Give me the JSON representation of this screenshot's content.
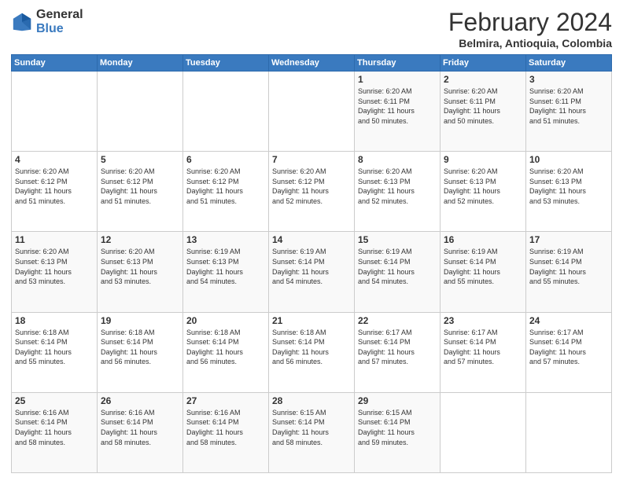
{
  "logo": {
    "general": "General",
    "blue": "Blue"
  },
  "header": {
    "month": "February 2024",
    "location": "Belmira, Antioquia, Colombia"
  },
  "weekdays": [
    "Sunday",
    "Monday",
    "Tuesday",
    "Wednesday",
    "Thursday",
    "Friday",
    "Saturday"
  ],
  "weeks": [
    [
      {
        "day": "",
        "info": ""
      },
      {
        "day": "",
        "info": ""
      },
      {
        "day": "",
        "info": ""
      },
      {
        "day": "",
        "info": ""
      },
      {
        "day": "1",
        "info": "Sunrise: 6:20 AM\nSunset: 6:11 PM\nDaylight: 11 hours\nand 50 minutes."
      },
      {
        "day": "2",
        "info": "Sunrise: 6:20 AM\nSunset: 6:11 PM\nDaylight: 11 hours\nand 50 minutes."
      },
      {
        "day": "3",
        "info": "Sunrise: 6:20 AM\nSunset: 6:11 PM\nDaylight: 11 hours\nand 51 minutes."
      }
    ],
    [
      {
        "day": "4",
        "info": "Sunrise: 6:20 AM\nSunset: 6:12 PM\nDaylight: 11 hours\nand 51 minutes."
      },
      {
        "day": "5",
        "info": "Sunrise: 6:20 AM\nSunset: 6:12 PM\nDaylight: 11 hours\nand 51 minutes."
      },
      {
        "day": "6",
        "info": "Sunrise: 6:20 AM\nSunset: 6:12 PM\nDaylight: 11 hours\nand 51 minutes."
      },
      {
        "day": "7",
        "info": "Sunrise: 6:20 AM\nSunset: 6:12 PM\nDaylight: 11 hours\nand 52 minutes."
      },
      {
        "day": "8",
        "info": "Sunrise: 6:20 AM\nSunset: 6:13 PM\nDaylight: 11 hours\nand 52 minutes."
      },
      {
        "day": "9",
        "info": "Sunrise: 6:20 AM\nSunset: 6:13 PM\nDaylight: 11 hours\nand 52 minutes."
      },
      {
        "day": "10",
        "info": "Sunrise: 6:20 AM\nSunset: 6:13 PM\nDaylight: 11 hours\nand 53 minutes."
      }
    ],
    [
      {
        "day": "11",
        "info": "Sunrise: 6:20 AM\nSunset: 6:13 PM\nDaylight: 11 hours\nand 53 minutes."
      },
      {
        "day": "12",
        "info": "Sunrise: 6:20 AM\nSunset: 6:13 PM\nDaylight: 11 hours\nand 53 minutes."
      },
      {
        "day": "13",
        "info": "Sunrise: 6:19 AM\nSunset: 6:13 PM\nDaylight: 11 hours\nand 54 minutes."
      },
      {
        "day": "14",
        "info": "Sunrise: 6:19 AM\nSunset: 6:14 PM\nDaylight: 11 hours\nand 54 minutes."
      },
      {
        "day": "15",
        "info": "Sunrise: 6:19 AM\nSunset: 6:14 PM\nDaylight: 11 hours\nand 54 minutes."
      },
      {
        "day": "16",
        "info": "Sunrise: 6:19 AM\nSunset: 6:14 PM\nDaylight: 11 hours\nand 55 minutes."
      },
      {
        "day": "17",
        "info": "Sunrise: 6:19 AM\nSunset: 6:14 PM\nDaylight: 11 hours\nand 55 minutes."
      }
    ],
    [
      {
        "day": "18",
        "info": "Sunrise: 6:18 AM\nSunset: 6:14 PM\nDaylight: 11 hours\nand 55 minutes."
      },
      {
        "day": "19",
        "info": "Sunrise: 6:18 AM\nSunset: 6:14 PM\nDaylight: 11 hours\nand 56 minutes."
      },
      {
        "day": "20",
        "info": "Sunrise: 6:18 AM\nSunset: 6:14 PM\nDaylight: 11 hours\nand 56 minutes."
      },
      {
        "day": "21",
        "info": "Sunrise: 6:18 AM\nSunset: 6:14 PM\nDaylight: 11 hours\nand 56 minutes."
      },
      {
        "day": "22",
        "info": "Sunrise: 6:17 AM\nSunset: 6:14 PM\nDaylight: 11 hours\nand 57 minutes."
      },
      {
        "day": "23",
        "info": "Sunrise: 6:17 AM\nSunset: 6:14 PM\nDaylight: 11 hours\nand 57 minutes."
      },
      {
        "day": "24",
        "info": "Sunrise: 6:17 AM\nSunset: 6:14 PM\nDaylight: 11 hours\nand 57 minutes."
      }
    ],
    [
      {
        "day": "25",
        "info": "Sunrise: 6:16 AM\nSunset: 6:14 PM\nDaylight: 11 hours\nand 58 minutes."
      },
      {
        "day": "26",
        "info": "Sunrise: 6:16 AM\nSunset: 6:14 PM\nDaylight: 11 hours\nand 58 minutes."
      },
      {
        "day": "27",
        "info": "Sunrise: 6:16 AM\nSunset: 6:14 PM\nDaylight: 11 hours\nand 58 minutes."
      },
      {
        "day": "28",
        "info": "Sunrise: 6:15 AM\nSunset: 6:14 PM\nDaylight: 11 hours\nand 58 minutes."
      },
      {
        "day": "29",
        "info": "Sunrise: 6:15 AM\nSunset: 6:14 PM\nDaylight: 11 hours\nand 59 minutes."
      },
      {
        "day": "",
        "info": ""
      },
      {
        "day": "",
        "info": ""
      }
    ]
  ]
}
